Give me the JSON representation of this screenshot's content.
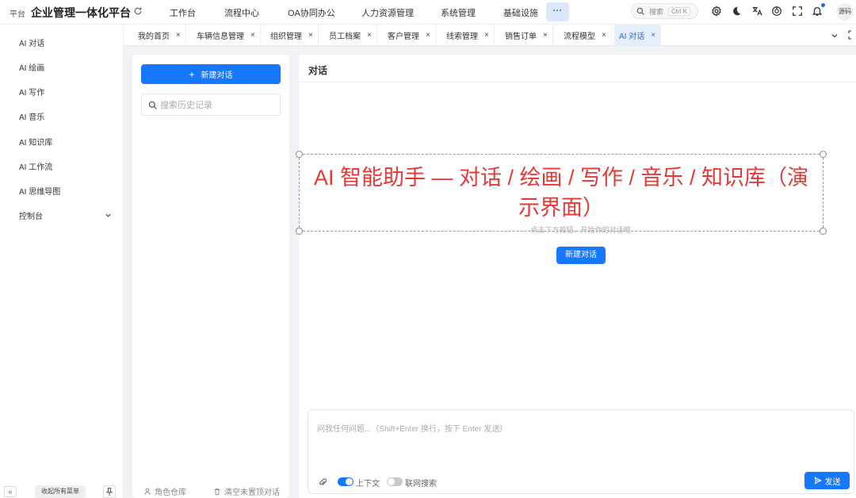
{
  "header": {
    "logo_small": "平台",
    "logo_title": "企业管理一体化平台",
    "nav": [
      "工作台",
      "流程中心",
      "OA协同办公",
      "人力资源管理",
      "系统管理",
      "基础设施"
    ],
    "more_label": "···",
    "search_label": "搜索",
    "search_shortcut": "Ctrl K",
    "avatar_label": "源码"
  },
  "sidebar": {
    "items": [
      "AI 对话",
      "AI 绘画",
      "AI 写作",
      "AI 音乐",
      "AI 知识库",
      "AI 工作流",
      "AI 思维导图",
      "控制台"
    ],
    "collapse_label": "收起所有菜单",
    "toggle_label": "«"
  },
  "tabs": [
    {
      "label": "我的首页"
    },
    {
      "label": "车辆信息管理"
    },
    {
      "label": "组织管理"
    },
    {
      "label": "员工档案"
    },
    {
      "label": "客户管理"
    },
    {
      "label": "线索管理"
    },
    {
      "label": "销售订单"
    },
    {
      "label": "流程模型"
    },
    {
      "label": "AI 对话",
      "active": true
    }
  ],
  "history": {
    "new_chat_label": "新建对话",
    "search_placeholder": "搜索历史记录",
    "footer_role": "角色仓库",
    "footer_clear": "清空未置顶对话"
  },
  "chat": {
    "title": "对话",
    "hint": "点击下方按钮，开始你的对话吧",
    "new_chat_label": "新建对话",
    "overlay_text": "AI 智能助手 — 对话 / 绘画 / 写作 / 音乐 / 知识库（演示界面）",
    "input_placeholder": "问我任何问题...（Shift+Enter 换行，按下 Enter 发送）",
    "context_label": "上下文",
    "context_on": true,
    "web_search_label": "联网搜索",
    "web_search_on": false,
    "send_label": "发送"
  },
  "colors": {
    "primary": "#1677ff",
    "overlay_text": "#e53935",
    "active_tab_bg": "#e4eefc"
  }
}
